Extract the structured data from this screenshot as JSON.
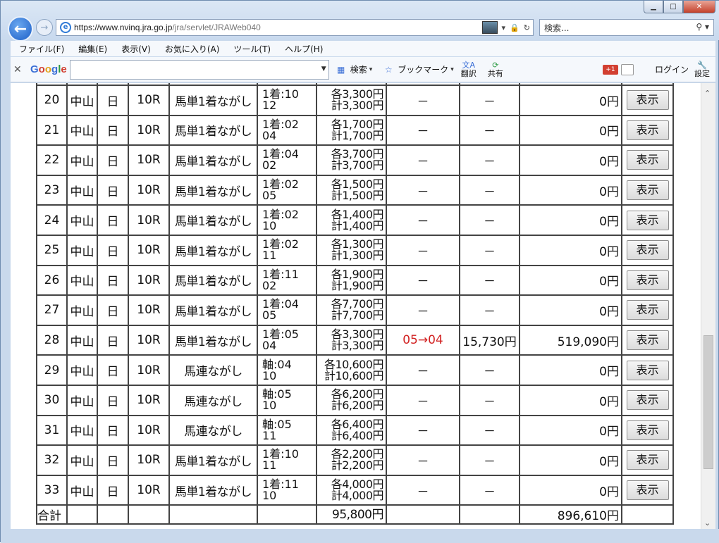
{
  "window": {
    "controls": {
      "min": "▁",
      "max": "□",
      "close": "✕"
    }
  },
  "address": {
    "url_host_prefix": "https://www.",
    "url_host": "nvinq.jra.go.jp",
    "url_path": "/jra/servlet/JRAWeb040",
    "search_placeholder": "検索..."
  },
  "menu": [
    "ファイル(F)",
    "編集(E)",
    "表示(V)",
    "お気に入り(A)",
    "ツール(T)",
    "ヘルプ(H)"
  ],
  "google_toolbar": {
    "logo": [
      "G",
      "o",
      "o",
      "g",
      "l",
      "e"
    ],
    "search_label": "検索",
    "bookmark_label": "ブックマーク",
    "translate_label": "翻訳",
    "share_label": "共有",
    "gplus_label": "+1",
    "login_label": "ログイン",
    "settings_label": "設定"
  },
  "table": {
    "show_label": "表示",
    "rows": [
      {
        "num": "20",
        "place": "中山",
        "day": "日",
        "race": "10R",
        "type": "馬単1着ながし",
        "combo1": "1着:10",
        "combo2": "12",
        "amt1": "各3,300円",
        "amt2": "計3,300円",
        "hit": "－",
        "odds": "－",
        "pay": "0円"
      },
      {
        "num": "21",
        "place": "中山",
        "day": "日",
        "race": "10R",
        "type": "馬単1着ながし",
        "combo1": "1着:02",
        "combo2": "04",
        "amt1": "各1,700円",
        "amt2": "計1,700円",
        "hit": "－",
        "odds": "－",
        "pay": "0円"
      },
      {
        "num": "22",
        "place": "中山",
        "day": "日",
        "race": "10R",
        "type": "馬単1着ながし",
        "combo1": "1着:04",
        "combo2": "02",
        "amt1": "各3,700円",
        "amt2": "計3,700円",
        "hit": "－",
        "odds": "－",
        "pay": "0円"
      },
      {
        "num": "23",
        "place": "中山",
        "day": "日",
        "race": "10R",
        "type": "馬単1着ながし",
        "combo1": "1着:02",
        "combo2": "05",
        "amt1": "各1,500円",
        "amt2": "計1,500円",
        "hit": "－",
        "odds": "－",
        "pay": "0円"
      },
      {
        "num": "24",
        "place": "中山",
        "day": "日",
        "race": "10R",
        "type": "馬単1着ながし",
        "combo1": "1着:02",
        "combo2": "10",
        "amt1": "各1,400円",
        "amt2": "計1,400円",
        "hit": "－",
        "odds": "－",
        "pay": "0円"
      },
      {
        "num": "25",
        "place": "中山",
        "day": "日",
        "race": "10R",
        "type": "馬単1着ながし",
        "combo1": "1着:02",
        "combo2": "11",
        "amt1": "各1,300円",
        "amt2": "計1,300円",
        "hit": "－",
        "odds": "－",
        "pay": "0円"
      },
      {
        "num": "26",
        "place": "中山",
        "day": "日",
        "race": "10R",
        "type": "馬単1着ながし",
        "combo1": "1着:11",
        "combo2": "02",
        "amt1": "各1,900円",
        "amt2": "計1,900円",
        "hit": "－",
        "odds": "－",
        "pay": "0円"
      },
      {
        "num": "27",
        "place": "中山",
        "day": "日",
        "race": "10R",
        "type": "馬単1着ながし",
        "combo1": "1着:04",
        "combo2": "05",
        "amt1": "各7,700円",
        "amt2": "計7,700円",
        "hit": "－",
        "odds": "－",
        "pay": "0円"
      },
      {
        "num": "28",
        "place": "中山",
        "day": "日",
        "race": "10R",
        "type": "馬単1着ながし",
        "combo1": "1着:05",
        "combo2": "04",
        "amt1": "各3,300円",
        "amt2": "計3,300円",
        "hit": "05→04",
        "hit_color": "#d22222",
        "odds": "15,730円",
        "pay": "519,090円"
      },
      {
        "num": "29",
        "place": "中山",
        "day": "日",
        "race": "10R",
        "type": "馬連ながし",
        "combo1": "軸:04",
        "combo2": "10",
        "amt1": "各10,600円",
        "amt2": "計10,600円",
        "hit": "－",
        "odds": "－",
        "pay": "0円"
      },
      {
        "num": "30",
        "place": "中山",
        "day": "日",
        "race": "10R",
        "type": "馬連ながし",
        "combo1": "軸:05",
        "combo2": "10",
        "amt1": "各6,200円",
        "amt2": "計6,200円",
        "hit": "－",
        "odds": "－",
        "pay": "0円"
      },
      {
        "num": "31",
        "place": "中山",
        "day": "日",
        "race": "10R",
        "type": "馬連ながし",
        "combo1": "軸:05",
        "combo2": "11",
        "amt1": "各6,400円",
        "amt2": "計6,400円",
        "hit": "－",
        "odds": "－",
        "pay": "0円"
      },
      {
        "num": "32",
        "place": "中山",
        "day": "日",
        "race": "10R",
        "type": "馬単1着ながし",
        "combo1": "1着:10",
        "combo2": "11",
        "amt1": "各2,200円",
        "amt2": "計2,200円",
        "hit": "－",
        "odds": "－",
        "pay": "0円"
      },
      {
        "num": "33",
        "place": "中山",
        "day": "日",
        "race": "10R",
        "type": "馬単1着ながし",
        "combo1": "1着:11",
        "combo2": "10",
        "amt1": "各4,000円",
        "amt2": "計4,000円",
        "hit": "－",
        "odds": "－",
        "pay": "0円"
      }
    ],
    "total": {
      "label": "合計",
      "amount": "95,800円",
      "payout": "896,610円"
    }
  }
}
